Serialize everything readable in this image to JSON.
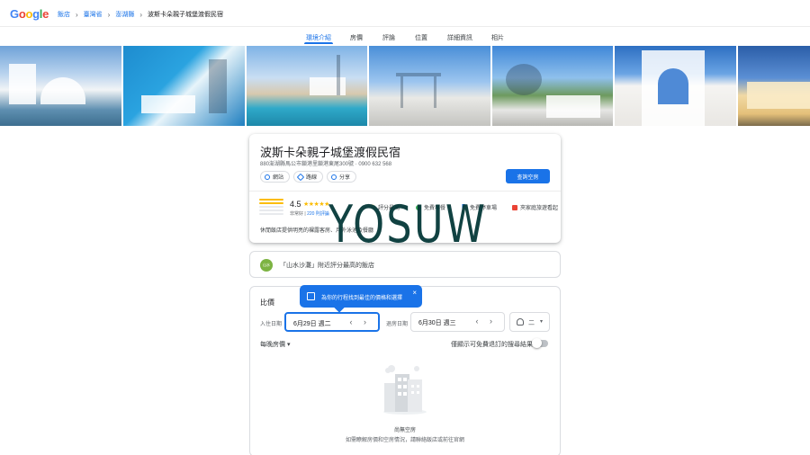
{
  "header": {
    "logo": [
      "G",
      "o",
      "o",
      "g",
      "l",
      "e"
    ],
    "breadcrumbs": [
      {
        "label": "飯店"
      },
      {
        "label": "臺灣省"
      },
      {
        "label": "澎湖縣"
      },
      {
        "label": "波斯卡朵親子城堡渡假民宿"
      }
    ]
  },
  "tabs": [
    "環境介紹",
    "房價",
    "評論",
    "位置",
    "詳細資訊",
    "相片"
  ],
  "hotel": {
    "name": "波斯卡朵親子城堡渡假民宿",
    "address": "880澎湖縣馬公市鎖港里鎖港東尾300號",
    "phone": "0900 632 568",
    "actions": [
      {
        "label": "網站",
        "icon": "globe-icon"
      },
      {
        "label": "路線",
        "icon": "directions-icon"
      },
      {
        "label": "分享",
        "icon": "share-icon"
      }
    ],
    "check_availability": "查詢空房",
    "rating": "4.5",
    "stars": "★★★★★",
    "rating_word": "非常好",
    "review_count": "220 則評論",
    "amenities": [
      {
        "label": "評分最高",
        "icon": "star-outline-icon"
      },
      {
        "label": "免費早餐",
        "icon": "breakfast-icon"
      },
      {
        "label": "免費停車場",
        "icon": "parking-icon"
      },
      {
        "label": "夾家庭旅遊看起",
        "icon": "family-icon"
      }
    ],
    "description": "休閒飯店提供明亮的裸露客房、戶外泳池及餐廳"
  },
  "watermark": "YOSUW",
  "promo": {
    "avatar_text": "山水",
    "text": "「山水沙灘」附近評分最高的飯店"
  },
  "prices": {
    "title": "比價",
    "tooltip": "為你的行程找到最佳的價格和選擇",
    "tooltip_close": "×",
    "checkin_label": "入住日期",
    "checkin_value": "6月29日 週二",
    "checkout_label": "退房日期",
    "checkout_value": "6月30日 週三",
    "date_nav": "‹ ›",
    "guests": "二",
    "guests_caret": "▾",
    "per_night": "每晚房價 ▾",
    "free_cancel": "僅顯示可免費退訂的搜尋結果",
    "empty_title": "尚無空房",
    "empty_sub": "如需瞭解房價和空房情況，請聯絡飯店或前往官網"
  }
}
